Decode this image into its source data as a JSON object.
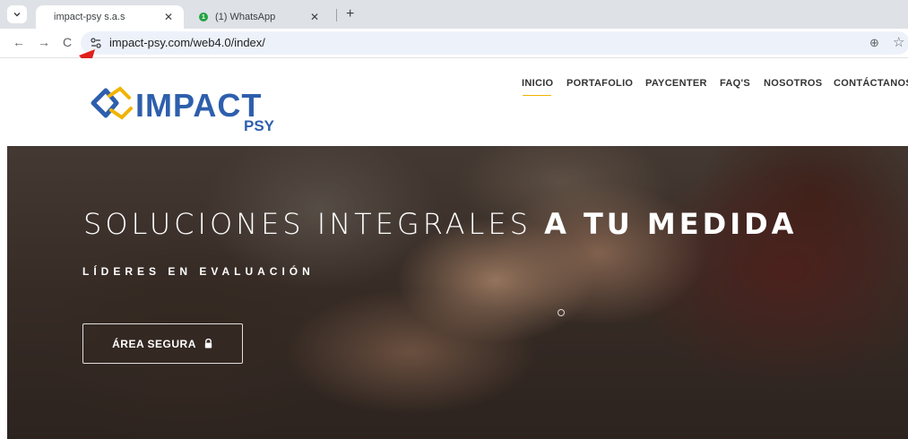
{
  "browser": {
    "tabs": [
      {
        "title": "impact-psy s.a.s",
        "active": true
      },
      {
        "title": "(1) WhatsApp",
        "active": false,
        "badge": "1"
      }
    ],
    "url": "impact-psy.com/web4.0/index/"
  },
  "site": {
    "logo": {
      "text": "IMPACT",
      "sub": "PSY"
    },
    "nav": [
      "INICIO",
      "PORTAFOLIO",
      "PAYCENTER",
      "FAQ'S",
      "NOSOTROS",
      "CONTÁCTANOS"
    ],
    "active_nav": "INICIO",
    "accent_color": "#f0b400",
    "brand_color": "#2e5fad"
  },
  "hero": {
    "title_light": "SOLUCIONES INTEGRALES",
    "title_bold": "A TU MEDIDA",
    "subtitle": "LÍDERES EN EVALUACIÓN",
    "button_label": "ÁREA SEGURA"
  },
  "annotation": {
    "arrow_color": "#e0201c"
  }
}
